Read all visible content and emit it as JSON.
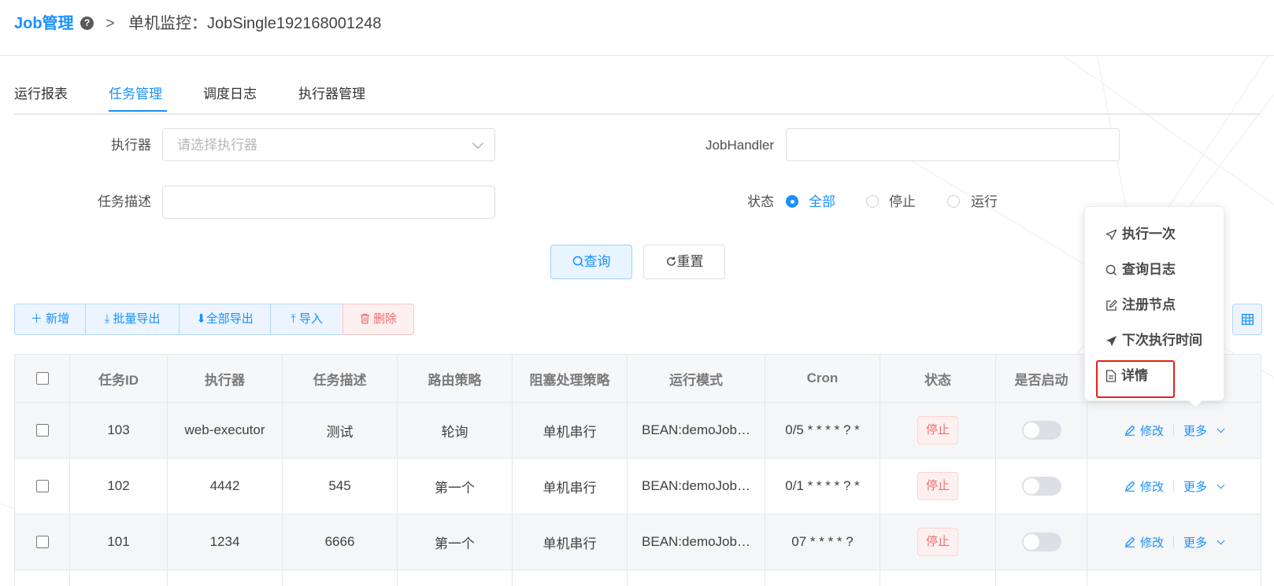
{
  "header": {
    "brand": "Job管理",
    "help": "?",
    "separator": ">",
    "title": "单机监控：JobSingle192168001248"
  },
  "tabs": [
    {
      "label": "运行报表",
      "active": false
    },
    {
      "label": "任务管理",
      "active": true
    },
    {
      "label": "调度日志",
      "active": false
    },
    {
      "label": "执行器管理",
      "active": false
    }
  ],
  "filters": {
    "executor_label": "执行器",
    "executor_placeholder": "请选择执行器",
    "jobhandler_label": "JobHandler",
    "jobhandler_value": "",
    "desc_label": "任务描述",
    "desc_value": "",
    "status_label": "状态",
    "status_options": [
      "全部",
      "停止",
      "运行"
    ],
    "status_selected": "全部"
  },
  "actions": {
    "query": "查询",
    "reset": "重置"
  },
  "toolbar": {
    "add": "新增",
    "batch_export": "批量导出",
    "export_all": "全部导出",
    "import": "导入",
    "delete": "删除"
  },
  "table": {
    "columns": [
      "任务ID",
      "执行器",
      "任务描述",
      "路由策略",
      "阻塞处理策略",
      "运行模式",
      "Cron",
      "状态",
      "是否启动"
    ],
    "rows": [
      {
        "id": "103",
        "executor": "web-executor",
        "desc": "测试",
        "route": "轮询",
        "block": "单机串行",
        "mode": "BEAN:demoJob…",
        "cron": "0/5 * * * * ? *",
        "status": "停止",
        "edit": "修改",
        "more": "更多"
      },
      {
        "id": "102",
        "executor": "4442",
        "desc": "545",
        "route": "第一个",
        "block": "单机串行",
        "mode": "BEAN:demoJob…",
        "cron": "0/1 * * * * ? *",
        "status": "停止",
        "edit": "修改",
        "more": "更多"
      },
      {
        "id": "101",
        "executor": "1234",
        "desc": "6666",
        "route": "第一个",
        "block": "单机串行",
        "mode": "BEAN:demoJob…",
        "cron": "07 * * * * ?",
        "status": "停止",
        "edit": "修改",
        "more": "更多"
      }
    ]
  },
  "dropdown": {
    "items": [
      "执行一次",
      "查询日志",
      "注册节点",
      "下次执行时间",
      "详情"
    ],
    "highlighted": "详情"
  },
  "colors": {
    "primary": "#1890ff",
    "danger": "#f56c6c",
    "highlight": "#e8201a"
  }
}
